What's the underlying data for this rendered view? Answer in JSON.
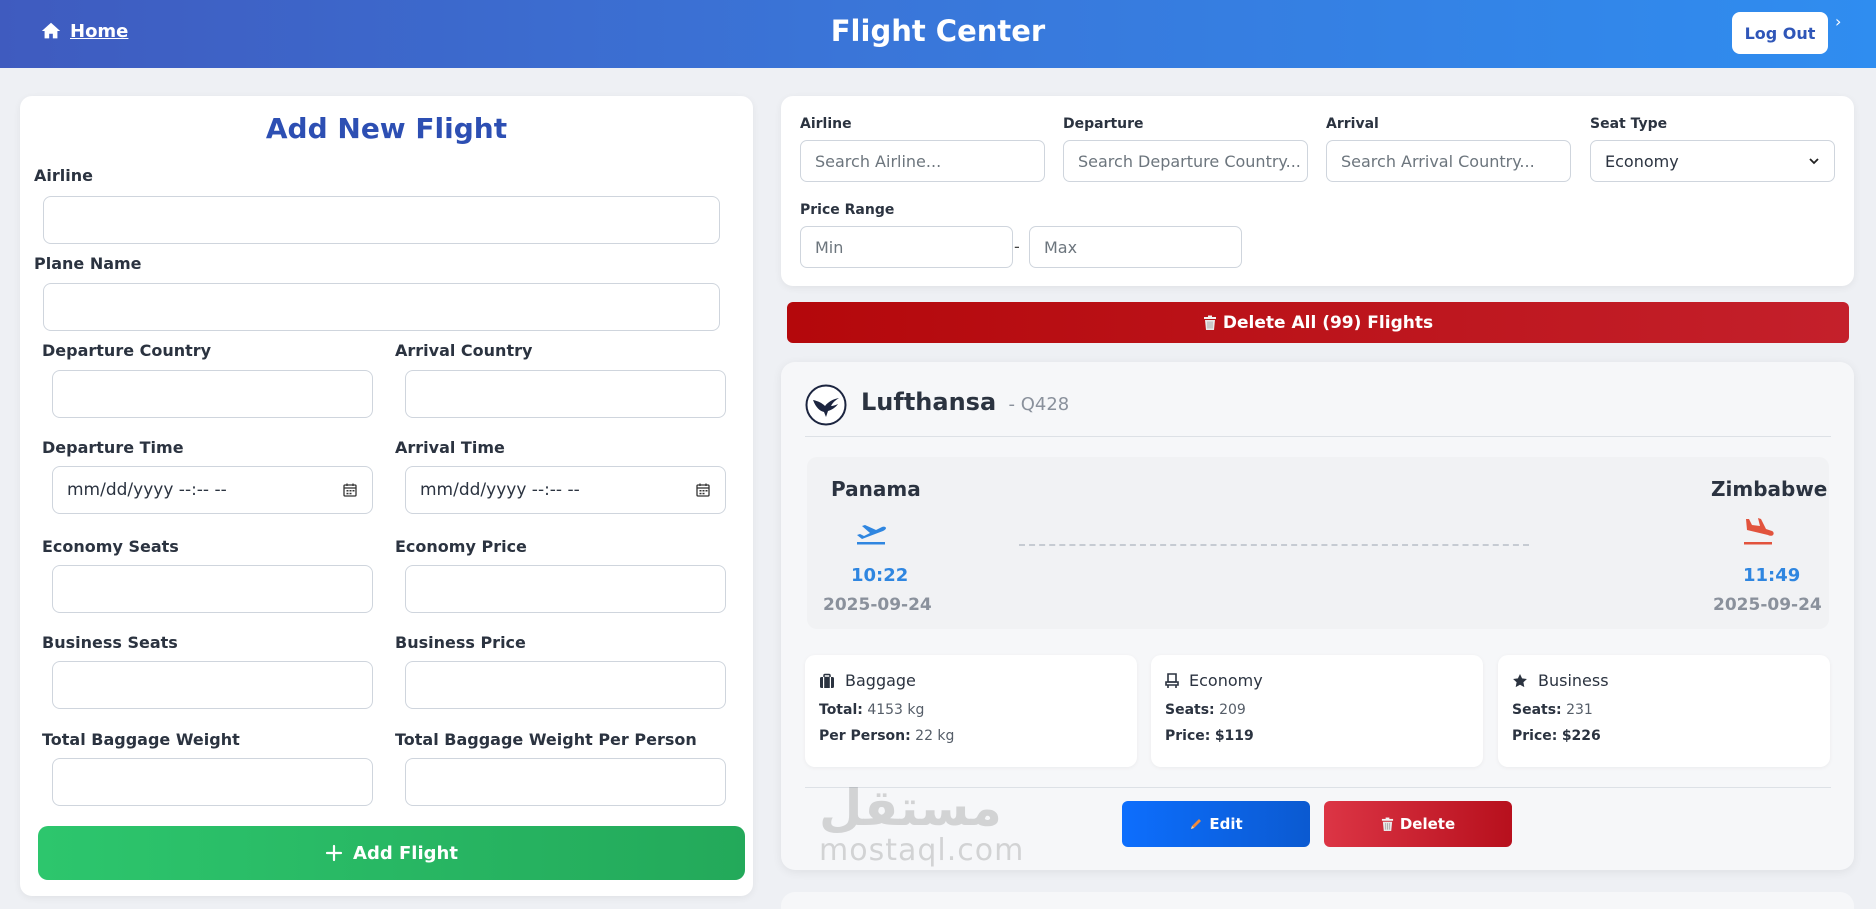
{
  "header": {
    "home_label": "Home",
    "title": "Flight Center",
    "logout_label": "Log Out",
    "chevron": "›"
  },
  "form": {
    "title": "Add New Flight",
    "airline_label": "Airline",
    "plane_label": "Plane Name",
    "departure_country_label": "Departure Country",
    "arrival_country_label": "Arrival Country",
    "departure_time_label": "Departure Time",
    "arrival_time_label": "Arrival Time",
    "datetime_placeholder": "mm/dd/yyyy --:-- --",
    "economy_seats_label": "Economy Seats",
    "economy_price_label": "Economy Price",
    "business_seats_label": "Business Seats",
    "business_price_label": "Business Price",
    "baggage_weight_label": "Total Baggage Weight",
    "baggage_per_person_label": "Total Baggage Weight Per Person",
    "submit_label": "Add Flight"
  },
  "filters": {
    "airline_label": "Airline",
    "airline_placeholder": "Search Airline...",
    "departure_label": "Departure",
    "departure_placeholder": "Search Departure Country...",
    "arrival_label": "Arrival",
    "arrival_placeholder": "Search Arrival Country...",
    "seat_type_label": "Seat Type",
    "seat_type_value": "Economy",
    "price_range_label": "Price Range",
    "min_placeholder": "Min",
    "dash": "-",
    "max_placeholder": "Max"
  },
  "delete_all_label": "Delete All (99) Flights",
  "flight": {
    "airline": "Lufthansa",
    "code": "- Q428",
    "from_city": "Panama",
    "to_city": "Zimbabwe",
    "dep_time": "10:22",
    "arr_time": "11:49",
    "dep_date": "2025-09-24",
    "arr_date": "2025-09-24",
    "baggage": {
      "title": "Baggage",
      "total_label": "Total:",
      "total_value": "4153 kg",
      "per_person_label": "Per Person:",
      "per_person_value": "22 kg"
    },
    "economy": {
      "title": "Economy",
      "seats_label": "Seats:",
      "seats_value": "209",
      "price_label": "Price:",
      "price_value": "$119"
    },
    "business": {
      "title": "Business",
      "seats_label": "Seats:",
      "seats_value": "231",
      "price_label": "Price:",
      "price_value": "$226"
    },
    "edit_label": "Edit",
    "delete_label": "Delete"
  },
  "watermark": {
    "arabic": "مستقل",
    "latin": "mostaql.com"
  },
  "colors": {
    "header_start": "#3f5bbf",
    "header_end": "#2f8df0",
    "form_title": "#2d4fb3",
    "add_button": "#2dc66d",
    "delete_all": "#b4080b",
    "edit_button": "#0d6efd",
    "delete_button": "#dc3545",
    "time_blue": "#2f86e0"
  }
}
